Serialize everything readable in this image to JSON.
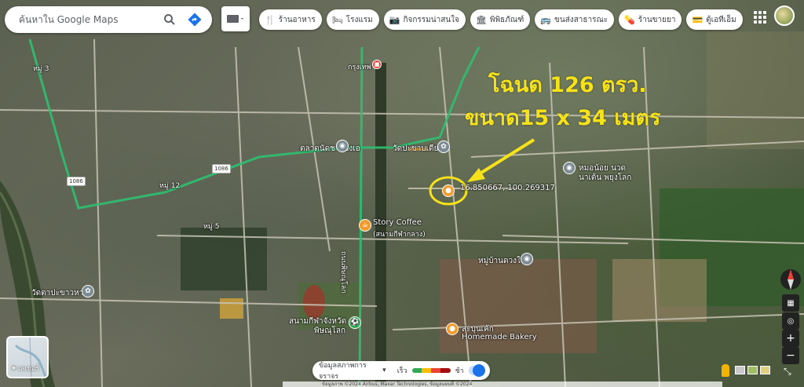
{
  "search": {
    "placeholder": "ค้นหาใน Google Maps"
  },
  "chips": [
    {
      "icon": "fork-knife-icon",
      "glyph": "🍴",
      "label": "ร้านอาหาร"
    },
    {
      "icon": "bed-icon",
      "glyph": "🛏",
      "label": "โรงแรม"
    },
    {
      "icon": "camera-icon",
      "glyph": "📷",
      "label": "กิจกรรมน่าสนใจ"
    },
    {
      "icon": "museum-icon",
      "glyph": "🏛",
      "label": "พิพิธภัณฑ์"
    },
    {
      "icon": "bus-icon",
      "glyph": "🚌",
      "label": "ขนส่งสาธารณะ"
    },
    {
      "icon": "pharmacy-icon",
      "glyph": "💊",
      "label": "ร้านขายยา"
    },
    {
      "icon": "atm-icon",
      "glyph": "💳",
      "label": "ตู้เอทีเอ็ม"
    }
  ],
  "annotation": {
    "line1": "โฉนด 126 ตรว.",
    "line2": "ขนาด15 x 34 เมตร"
  },
  "colors": {
    "annotation": "#f5e21a",
    "road_highway": "#2fbf71",
    "pin_orange": "#f29b2c",
    "pin_gray": "#7c8b93",
    "pin_green": "#34a853"
  },
  "places": {
    "coords": "16.850667, 100.269317",
    "wat_pakhanyai": "วัดปะขาบเดีย",
    "talad": "ตลาดนัดชายอิงเอ",
    "moh_noi": "หมอน้อย นวด",
    "moh_noi_2": "นาเต้น พยุงโลก",
    "story_coffee": "Story Coffee",
    "story_coffee_sub": "(สนามกีฬากลาง)",
    "moo_ban": "หมู่บ้านดวงใจ",
    "wat_left": "วัดตาปะขาวหาย",
    "stadium": "สนามกีฬาจังหวัด",
    "stadium_2": "พิษณุโลก",
    "bakery_1": "สะบุนเค้ก",
    "bakery_2": "Homemade Bakery",
    "kru": "กรุงเทพ",
    "moo3": "หมู่ 3",
    "moo12": "หมู่ 12",
    "moo5": "หมู่ 5",
    "road_1086a": "1086",
    "road_1086b": "1086",
    "road_main": "ถนนพิษณุโลก"
  },
  "layers": {
    "label": "เลเยอร์"
  },
  "traffic": {
    "label": "ข้อมูลสภาพการจราจร",
    "fast": "เร็ว",
    "slow": "ช้า",
    "colors": [
      "#34a853",
      "#fbbc04",
      "#ea4335",
      "#a50e0e"
    ]
  },
  "footer": {
    "text": "ข้อมูลภาพ ©2024 Airbus, Maxar Technologies, ข้อมูลแผนที่ ©2024"
  },
  "scale": {
    "label": "200 ม."
  }
}
